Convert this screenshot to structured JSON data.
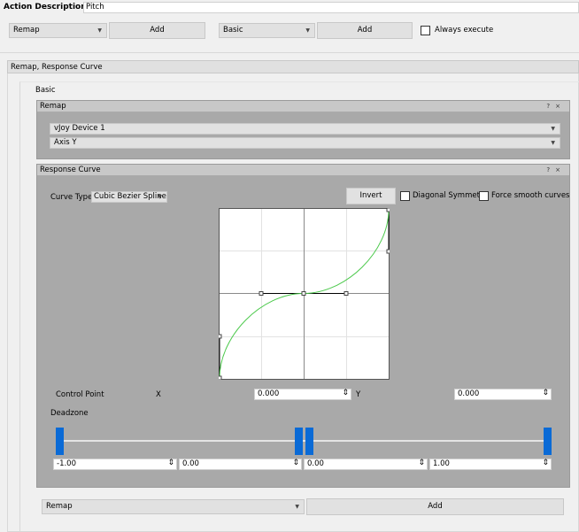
{
  "action_description": {
    "label": "Action Description",
    "value": "Pitch"
  },
  "top_bar": {
    "action_combo": "Remap",
    "add_action_label": "Add",
    "container_combo": "Basic",
    "add_container_label": "Add",
    "always_execute_label": "Always execute",
    "always_execute_checked": false
  },
  "container_panel": {
    "title": "Remap, Response Curve",
    "tab_label": "Basic"
  },
  "remap_widget": {
    "title": "Remap",
    "device_combo": "vJoy Device 1",
    "axis_combo": "Axis Y",
    "help_icon": "?",
    "close_icon": "×"
  },
  "response_curve_widget": {
    "title": "Response Curve",
    "curve_type_label": "Curve Type:",
    "curve_type_value": "Cubic Bezier Spline",
    "invert_label": "Invert",
    "diagonal_symmetry_label": "Diagonal Symmetry",
    "diagonal_symmetry_checked": false,
    "force_smooth_label": "Force smooth curves",
    "force_smooth_checked": false,
    "help_icon": "?",
    "close_icon": "×",
    "control_point_label": "Control Point",
    "x_label": "X",
    "x_value": "0.000",
    "y_label": "Y",
    "y_value": "0.000",
    "deadzone_label": "Deadzone",
    "deadzone_values": [
      "-1.00",
      "0.00",
      "0.00",
      "1.00"
    ]
  },
  "bottom_bar": {
    "action_combo": "Remap",
    "add_label": "Add"
  },
  "colors": {
    "curve": "#4bc94b",
    "handle": "#0a6ad6",
    "widget_bg": "#a9a9a9"
  }
}
